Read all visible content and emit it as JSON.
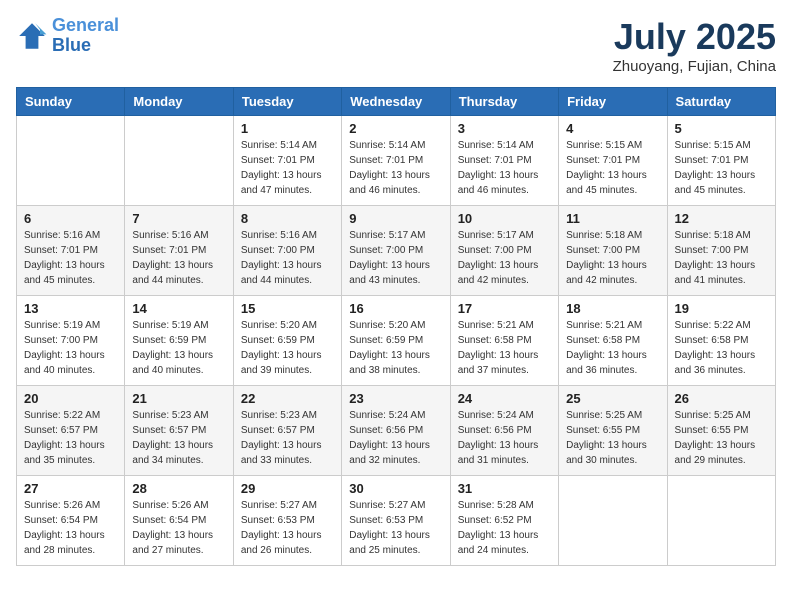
{
  "header": {
    "logo_line1": "General",
    "logo_line2": "Blue",
    "month": "July 2025",
    "location": "Zhuoyang, Fujian, China"
  },
  "weekdays": [
    "Sunday",
    "Monday",
    "Tuesday",
    "Wednesday",
    "Thursday",
    "Friday",
    "Saturday"
  ],
  "weeks": [
    [
      {
        "day": "",
        "sunrise": "",
        "sunset": "",
        "daylight": ""
      },
      {
        "day": "",
        "sunrise": "",
        "sunset": "",
        "daylight": ""
      },
      {
        "day": "1",
        "sunrise": "Sunrise: 5:14 AM",
        "sunset": "Sunset: 7:01 PM",
        "daylight": "Daylight: 13 hours and 47 minutes."
      },
      {
        "day": "2",
        "sunrise": "Sunrise: 5:14 AM",
        "sunset": "Sunset: 7:01 PM",
        "daylight": "Daylight: 13 hours and 46 minutes."
      },
      {
        "day": "3",
        "sunrise": "Sunrise: 5:14 AM",
        "sunset": "Sunset: 7:01 PM",
        "daylight": "Daylight: 13 hours and 46 minutes."
      },
      {
        "day": "4",
        "sunrise": "Sunrise: 5:15 AM",
        "sunset": "Sunset: 7:01 PM",
        "daylight": "Daylight: 13 hours and 45 minutes."
      },
      {
        "day": "5",
        "sunrise": "Sunrise: 5:15 AM",
        "sunset": "Sunset: 7:01 PM",
        "daylight": "Daylight: 13 hours and 45 minutes."
      }
    ],
    [
      {
        "day": "6",
        "sunrise": "Sunrise: 5:16 AM",
        "sunset": "Sunset: 7:01 PM",
        "daylight": "Daylight: 13 hours and 45 minutes."
      },
      {
        "day": "7",
        "sunrise": "Sunrise: 5:16 AM",
        "sunset": "Sunset: 7:01 PM",
        "daylight": "Daylight: 13 hours and 44 minutes."
      },
      {
        "day": "8",
        "sunrise": "Sunrise: 5:16 AM",
        "sunset": "Sunset: 7:00 PM",
        "daylight": "Daylight: 13 hours and 44 minutes."
      },
      {
        "day": "9",
        "sunrise": "Sunrise: 5:17 AM",
        "sunset": "Sunset: 7:00 PM",
        "daylight": "Daylight: 13 hours and 43 minutes."
      },
      {
        "day": "10",
        "sunrise": "Sunrise: 5:17 AM",
        "sunset": "Sunset: 7:00 PM",
        "daylight": "Daylight: 13 hours and 42 minutes."
      },
      {
        "day": "11",
        "sunrise": "Sunrise: 5:18 AM",
        "sunset": "Sunset: 7:00 PM",
        "daylight": "Daylight: 13 hours and 42 minutes."
      },
      {
        "day": "12",
        "sunrise": "Sunrise: 5:18 AM",
        "sunset": "Sunset: 7:00 PM",
        "daylight": "Daylight: 13 hours and 41 minutes."
      }
    ],
    [
      {
        "day": "13",
        "sunrise": "Sunrise: 5:19 AM",
        "sunset": "Sunset: 7:00 PM",
        "daylight": "Daylight: 13 hours and 40 minutes."
      },
      {
        "day": "14",
        "sunrise": "Sunrise: 5:19 AM",
        "sunset": "Sunset: 6:59 PM",
        "daylight": "Daylight: 13 hours and 40 minutes."
      },
      {
        "day": "15",
        "sunrise": "Sunrise: 5:20 AM",
        "sunset": "Sunset: 6:59 PM",
        "daylight": "Daylight: 13 hours and 39 minutes."
      },
      {
        "day": "16",
        "sunrise": "Sunrise: 5:20 AM",
        "sunset": "Sunset: 6:59 PM",
        "daylight": "Daylight: 13 hours and 38 minutes."
      },
      {
        "day": "17",
        "sunrise": "Sunrise: 5:21 AM",
        "sunset": "Sunset: 6:58 PM",
        "daylight": "Daylight: 13 hours and 37 minutes."
      },
      {
        "day": "18",
        "sunrise": "Sunrise: 5:21 AM",
        "sunset": "Sunset: 6:58 PM",
        "daylight": "Daylight: 13 hours and 36 minutes."
      },
      {
        "day": "19",
        "sunrise": "Sunrise: 5:22 AM",
        "sunset": "Sunset: 6:58 PM",
        "daylight": "Daylight: 13 hours and 36 minutes."
      }
    ],
    [
      {
        "day": "20",
        "sunrise": "Sunrise: 5:22 AM",
        "sunset": "Sunset: 6:57 PM",
        "daylight": "Daylight: 13 hours and 35 minutes."
      },
      {
        "day": "21",
        "sunrise": "Sunrise: 5:23 AM",
        "sunset": "Sunset: 6:57 PM",
        "daylight": "Daylight: 13 hours and 34 minutes."
      },
      {
        "day": "22",
        "sunrise": "Sunrise: 5:23 AM",
        "sunset": "Sunset: 6:57 PM",
        "daylight": "Daylight: 13 hours and 33 minutes."
      },
      {
        "day": "23",
        "sunrise": "Sunrise: 5:24 AM",
        "sunset": "Sunset: 6:56 PM",
        "daylight": "Daylight: 13 hours and 32 minutes."
      },
      {
        "day": "24",
        "sunrise": "Sunrise: 5:24 AM",
        "sunset": "Sunset: 6:56 PM",
        "daylight": "Daylight: 13 hours and 31 minutes."
      },
      {
        "day": "25",
        "sunrise": "Sunrise: 5:25 AM",
        "sunset": "Sunset: 6:55 PM",
        "daylight": "Daylight: 13 hours and 30 minutes."
      },
      {
        "day": "26",
        "sunrise": "Sunrise: 5:25 AM",
        "sunset": "Sunset: 6:55 PM",
        "daylight": "Daylight: 13 hours and 29 minutes."
      }
    ],
    [
      {
        "day": "27",
        "sunrise": "Sunrise: 5:26 AM",
        "sunset": "Sunset: 6:54 PM",
        "daylight": "Daylight: 13 hours and 28 minutes."
      },
      {
        "day": "28",
        "sunrise": "Sunrise: 5:26 AM",
        "sunset": "Sunset: 6:54 PM",
        "daylight": "Daylight: 13 hours and 27 minutes."
      },
      {
        "day": "29",
        "sunrise": "Sunrise: 5:27 AM",
        "sunset": "Sunset: 6:53 PM",
        "daylight": "Daylight: 13 hours and 26 minutes."
      },
      {
        "day": "30",
        "sunrise": "Sunrise: 5:27 AM",
        "sunset": "Sunset: 6:53 PM",
        "daylight": "Daylight: 13 hours and 25 minutes."
      },
      {
        "day": "31",
        "sunrise": "Sunrise: 5:28 AM",
        "sunset": "Sunset: 6:52 PM",
        "daylight": "Daylight: 13 hours and 24 minutes."
      },
      {
        "day": "",
        "sunrise": "",
        "sunset": "",
        "daylight": ""
      },
      {
        "day": "",
        "sunrise": "",
        "sunset": "",
        "daylight": ""
      }
    ]
  ]
}
